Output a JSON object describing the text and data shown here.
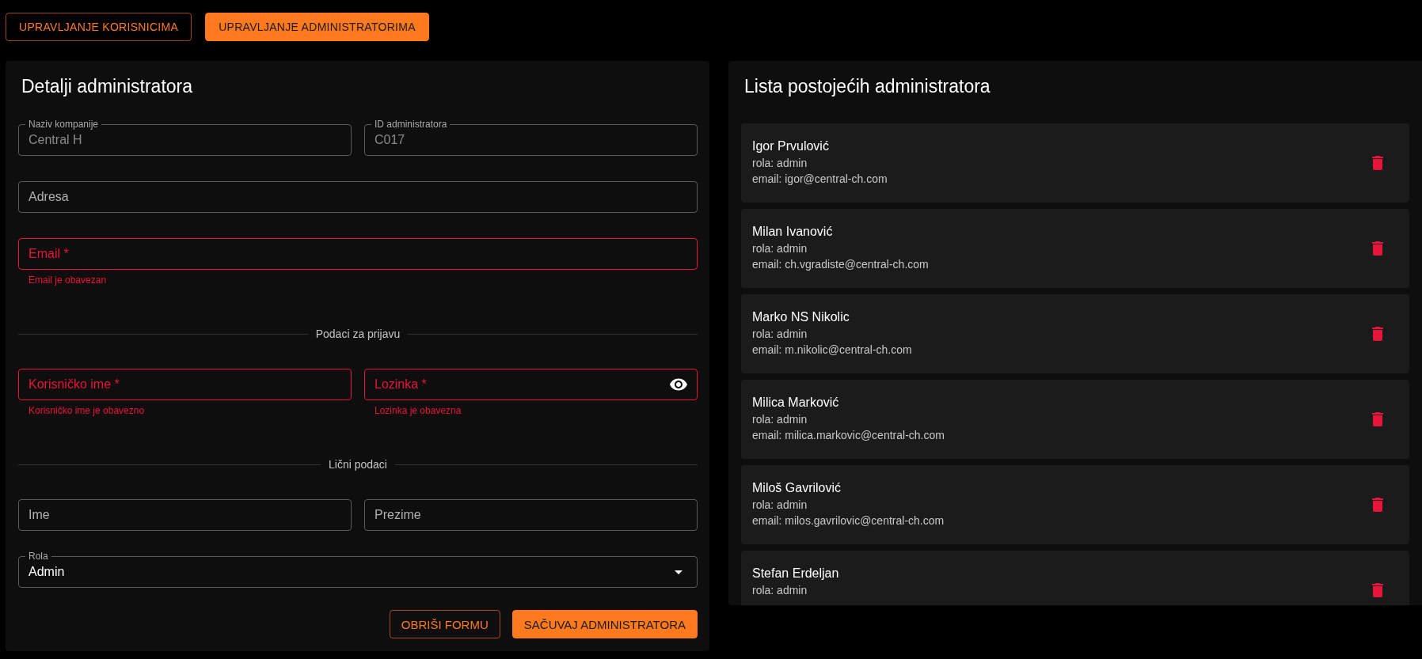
{
  "tabs": [
    {
      "label": "UPRAVLJANJE KORISNICIMA",
      "selected": false
    },
    {
      "label": "UPRAVLJANJE ADMINISTRATORIMA",
      "selected": true
    }
  ],
  "form": {
    "title": "Detalji administratora",
    "sections": [
      {
        "kind": "fields",
        "fields": [
          {
            "label": "Naziv kompanije",
            "value": "Central H",
            "disabled": true,
            "invalid": false
          },
          {
            "label": "ID administratora",
            "value": "C017",
            "disabled": true,
            "invalid": false
          }
        ]
      },
      {
        "kind": "fields",
        "fields": [
          {
            "label": "Adresa",
            "disabled": false,
            "invalid": false
          }
        ]
      },
      {
        "kind": "fields",
        "fields": [
          {
            "label": "Email *",
            "disabled": false,
            "invalid": true,
            "error": "Email je obavezan"
          }
        ]
      },
      {
        "kind": "divider",
        "label": "Podaci za prijavu"
      },
      {
        "kind": "fields",
        "fields": [
          {
            "label": "Korisničko ime *",
            "disabled": false,
            "invalid": true,
            "error": "Korisničko ime je obavezno"
          },
          {
            "label": "Lozinka *",
            "disabled": false,
            "invalid": true,
            "error": "Lozinka je obavezna",
            "kind": "password"
          }
        ]
      },
      {
        "kind": "divider",
        "label": "Lični podaci"
      },
      {
        "kind": "fields",
        "fields": [
          {
            "label": "Ime",
            "disabled": false,
            "invalid": false
          },
          {
            "label": "Prezime",
            "disabled": false,
            "invalid": false
          }
        ]
      },
      {
        "kind": "fields",
        "fields": [
          {
            "label": "Rola",
            "value": "Admin",
            "disabled": false,
            "invalid": false,
            "kind": "select"
          }
        ]
      }
    ],
    "buttons": [
      {
        "label": "OBRIŠI FORMU",
        "kind": "outlined"
      },
      {
        "label": "SAČUVAJ ADMINISTRATORA",
        "kind": "contained"
      }
    ]
  },
  "list": {
    "title": "Lista postojećih administratora",
    "items": [
      {
        "name": "Igor Prvulović",
        "role": "rola: admin",
        "email": "email: igor@central-ch.com"
      },
      {
        "name": "Milan Ivanović",
        "role": "rola: admin",
        "email": "email: ch.vgradiste@central-ch.com"
      },
      {
        "name": "Marko NS Nikolic",
        "role": "rola: admin",
        "email": "email: m.nikolic@central-ch.com"
      },
      {
        "name": "Milica Marković",
        "role": "rola: admin",
        "email": "email: milica.markovic@central-ch.com"
      },
      {
        "name": "Miloš Gavrilović",
        "role": "rola: admin",
        "email": "email: milos.gavrilovic@central-ch.com"
      },
      {
        "name": "Stefan Erdeljan",
        "role": "rola: admin"
      }
    ]
  }
}
